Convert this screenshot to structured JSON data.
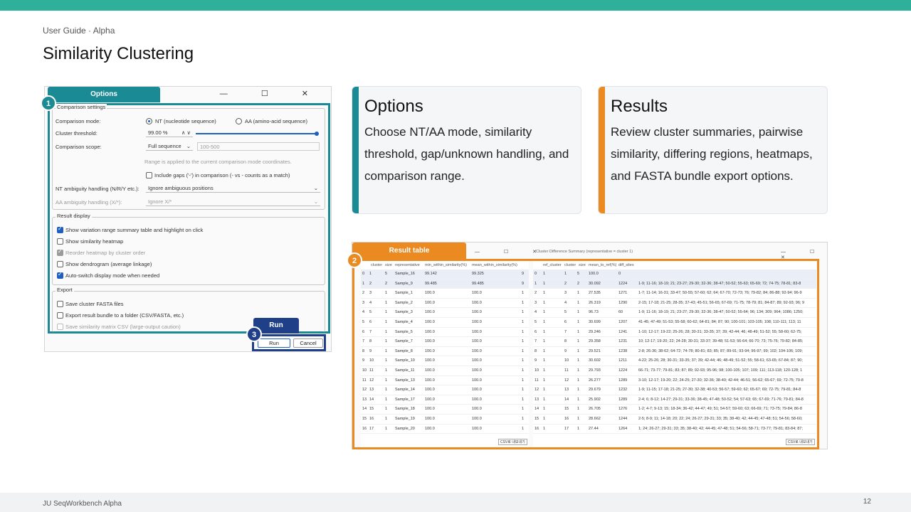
{
  "header": {
    "breadcrumb": "User Guide · Alpha",
    "title": "Similarity Clustering"
  },
  "footer": {
    "left": "JU SeqWorkbench Alpha",
    "page": "12"
  },
  "dialog": {
    "tab_label": "Options",
    "callout1": "1",
    "win_controls": "— ☐ ✕",
    "comparison": {
      "group_title": "Comparison settings",
      "mode_label": "Comparison mode:",
      "mode_nt": "NT (nucleotide sequence)",
      "mode_aa": "AA (amino-acid sequence)",
      "threshold_label": "Cluster threshold:",
      "threshold_value": "99.00 %",
      "scope_label": "Comparison scope:",
      "scope_value": "Full sequence",
      "range_placeholder": "100-500",
      "range_note": "Range is applied to the current comparison mode coordinates.",
      "gaps_label": "Include gaps ('-') in comparison (- vs - counts as a match)",
      "nt_amb_label": "NT ambiguity handling (N/R/Y etc.):",
      "nt_amb_value": "Ignore ambiguous positions",
      "aa_amb_label": "AA ambiguity handling (X/*):",
      "aa_amb_value": "Ignore X/*"
    },
    "display": {
      "group_title": "Result display",
      "opt1": "Show variation range summary table and highlight on click",
      "opt2": "Show similarity heatmap",
      "opt3": "Reorder heatmap by cluster order",
      "opt4": "Show dendrogram (average linkage)",
      "opt5": "Auto-switch display mode when needed"
    },
    "export": {
      "group_title": "Export",
      "opt1": "Save cluster FASTA files",
      "opt2": "Export result bundle to a folder (CSV/FASTA, etc.)",
      "opt3": "Save similarity matrix CSV (large-output caution)"
    },
    "run_tab": "Run",
    "callout3": "3",
    "run_button": "Run",
    "cancel_button": "Cancel"
  },
  "cards": [
    {
      "title": "Options",
      "body": "Choose NT/AA mode, similarity threshold, gap/unknown handling, and comparison range.",
      "color": "#1a8a94"
    },
    {
      "title": "Results",
      "body": "Review cluster summaries, pairwise similarity, differing regions, heatmaps, and FASTA bundle export options.",
      "color": "#ea8a21"
    }
  ],
  "results": {
    "tab_label": "Result table",
    "callout2": "2",
    "left_headers": [
      "cluster",
      "size",
      "representative",
      "min_within_similarity(%)",
      "mean_within_similarity(%)"
    ],
    "left_rows": [
      [
        "0",
        "1",
        "5",
        "Sample_16",
        "99.142",
        "99.325",
        "9"
      ],
      [
        "1",
        "2",
        "2",
        "Sample_9",
        "99.485",
        "99.485",
        "9"
      ],
      [
        "2",
        "3",
        "1",
        "Sample_1",
        "100.0",
        "100.0",
        "1"
      ],
      [
        "3",
        "4",
        "1",
        "Sample_2",
        "100.0",
        "100.0",
        "1"
      ],
      [
        "4",
        "5",
        "1",
        "Sample_3",
        "100.0",
        "100.0",
        "1"
      ],
      [
        "5",
        "6",
        "1",
        "Sample_4",
        "100.0",
        "100.0",
        "1"
      ],
      [
        "6",
        "7",
        "1",
        "Sample_5",
        "100.0",
        "100.0",
        "1"
      ],
      [
        "7",
        "8",
        "1",
        "Sample_7",
        "100.0",
        "100.0",
        "1"
      ],
      [
        "8",
        "9",
        "1",
        "Sample_8",
        "100.0",
        "100.0",
        "1"
      ],
      [
        "9",
        "10",
        "1",
        "Sample_10",
        "100.0",
        "100.0",
        "1"
      ],
      [
        "10",
        "11",
        "1",
        "Sample_11",
        "100.0",
        "100.0",
        "1"
      ],
      [
        "11",
        "12",
        "1",
        "Sample_13",
        "100.0",
        "100.0",
        "1"
      ],
      [
        "12",
        "13",
        "1",
        "Sample_14",
        "100.0",
        "100.0",
        "1"
      ],
      [
        "13",
        "14",
        "1",
        "Sample_17",
        "100.0",
        "100.0",
        "1"
      ],
      [
        "14",
        "15",
        "1",
        "Sample_18",
        "100.0",
        "100.0",
        "1"
      ],
      [
        "15",
        "16",
        "1",
        "Sample_19",
        "100.0",
        "100.0",
        "1"
      ],
      [
        "16",
        "17",
        "1",
        "Sample_20",
        "100.0",
        "100.0",
        "1"
      ]
    ],
    "left_export": "CSV로 내보내기",
    "right_title": "Cluster Difference Summary (representative = cluster 1)",
    "right_headers": [
      "ref_cluster",
      "cluster",
      "size",
      "mean_to_ref(%)",
      "diff_sites"
    ],
    "right_rows": [
      [
        "0",
        "1",
        "1",
        "5",
        "100.0",
        "0",
        ""
      ],
      [
        "1",
        "1",
        "2",
        "2",
        "30.092",
        "1224",
        "1-9; 11-16; 18-19; 21; 23-27; 29-30; 32-36; 38-47; 50-52; 55-63; 65-69; 72; 74-75; 78-81; 83-8"
      ],
      [
        "2",
        "1",
        "3",
        "1",
        "27.535",
        "1271",
        "1-7; 11-14; 16-31; 33-47; 50-55; 57-60; 62; 64; 67-70; 72-73; 76; 79-82; 84; 86-88; 92-94; 96-9"
      ],
      [
        "3",
        "1",
        "4",
        "1",
        "26.319",
        "1290",
        "2-15; 17-18; 21-25; 28-35; 37-43; 45-51; 56-65; 67-69; 71-75; 78-79; 81; 84-87; 89; 92-93; 96; 9"
      ],
      [
        "4",
        "1",
        "5",
        "1",
        "96.73",
        "60",
        "1-9; 11-16; 18-19; 21; 23-27; 29-30; 32-36; 38-47; 50-52; 55-64; 96; 134; 309; 964; 1086; 1250;"
      ],
      [
        "5",
        "1",
        "6",
        "1",
        "30.699",
        "1207",
        "41-45; 47-49; 51-53; 55-58; 60-62; 64-81; 84; 87; 90; 100-101; 103-105; 108; 110-111; 113; 11"
      ],
      [
        "6",
        "1",
        "7",
        "1",
        "29.246",
        "1241",
        "1-10; 12-17; 19-22; 25-26; 28; 30-31; 33-35; 37; 39; 42-44; 46; 48-49; 51-52; 55; 58-60; 62-75;"
      ],
      [
        "7",
        "1",
        "8",
        "1",
        "29.358",
        "1231",
        "10; 12-17; 19-20; 22; 24-28; 30-31; 33-37; 39-48; 51-53; 56-64; 66-70; 73; 75-76; 79-82; 84-85;"
      ],
      [
        "8",
        "1",
        "9",
        "1",
        "29.521",
        "1238",
        "2-8; 26-36; 38-62; 64-72; 74-78; 80-81; 83; 85; 87; 89-91; 93-94; 96-97; 99; 102; 104-106; 109;"
      ],
      [
        "9",
        "1",
        "10",
        "1",
        "30.602",
        "1211",
        "4-22; 25-26; 28; 30-31; 33-35; 37; 39; 42-44; 46; 48-49; 51-52; 55; 58-61; 63-65; 67-84; 87; 90;"
      ],
      [
        "10",
        "1",
        "11",
        "1",
        "29.793",
        "1224",
        "66-71; 73-77; 79-81; 83; 87; 89; 92-93; 95-96; 98; 100-105; 107; 109; 111; 113-118; 120-128; 1"
      ],
      [
        "11",
        "1",
        "12",
        "1",
        "26.277",
        "1289",
        "3-10; 12-17; 19-20; 22; 24-25; 27-30; 32-36; 38-40; 42-44; 46-51; 56-62; 65-67; 69; 72-75; 79-8"
      ],
      [
        "12",
        "1",
        "13",
        "1",
        "29.679",
        "1232",
        "1-9; 11-15; 17-18; 21-25; 27-30; 32-38; 40-53; 56-57; 59-60; 62; 65-67; 69; 72-75; 79-81; 84-8"
      ],
      [
        "13",
        "1",
        "14",
        "1",
        "25.902",
        "1289",
        "2-4; 6; 8-12; 14-27; 29-31; 33-36; 38-45; 47-48; 50-52; 54; 57-63; 65; 67-69; 71-76; 79-81; 84-8"
      ],
      [
        "14",
        "1",
        "15",
        "1",
        "26.705",
        "1276",
        "1-2; 4-7; 9-13; 15; 18-34; 36-42; 44-47; 49; 51; 54-57; 59-60; 63; 66-69; 71; 73-75; 79-84; 86-8"
      ],
      [
        "15",
        "1",
        "16",
        "1",
        "28.662",
        "1244",
        "2-5; 8-9; 11; 14-18; 20; 22; 24; 26-27; 29-31; 33; 35; 38-40; 42; 44-45; 47-48; 51; 54-56; 58-60;"
      ],
      [
        "16",
        "1",
        "17",
        "1",
        "27.44",
        "1264",
        "1; 24; 26-27; 29-31; 33; 35; 38-40; 42; 44-45; 47-48; 51; 54-56; 58-71; 73-77; 79-81; 83-84; 87;"
      ]
    ],
    "right_export": "CSV로 내보내기"
  }
}
